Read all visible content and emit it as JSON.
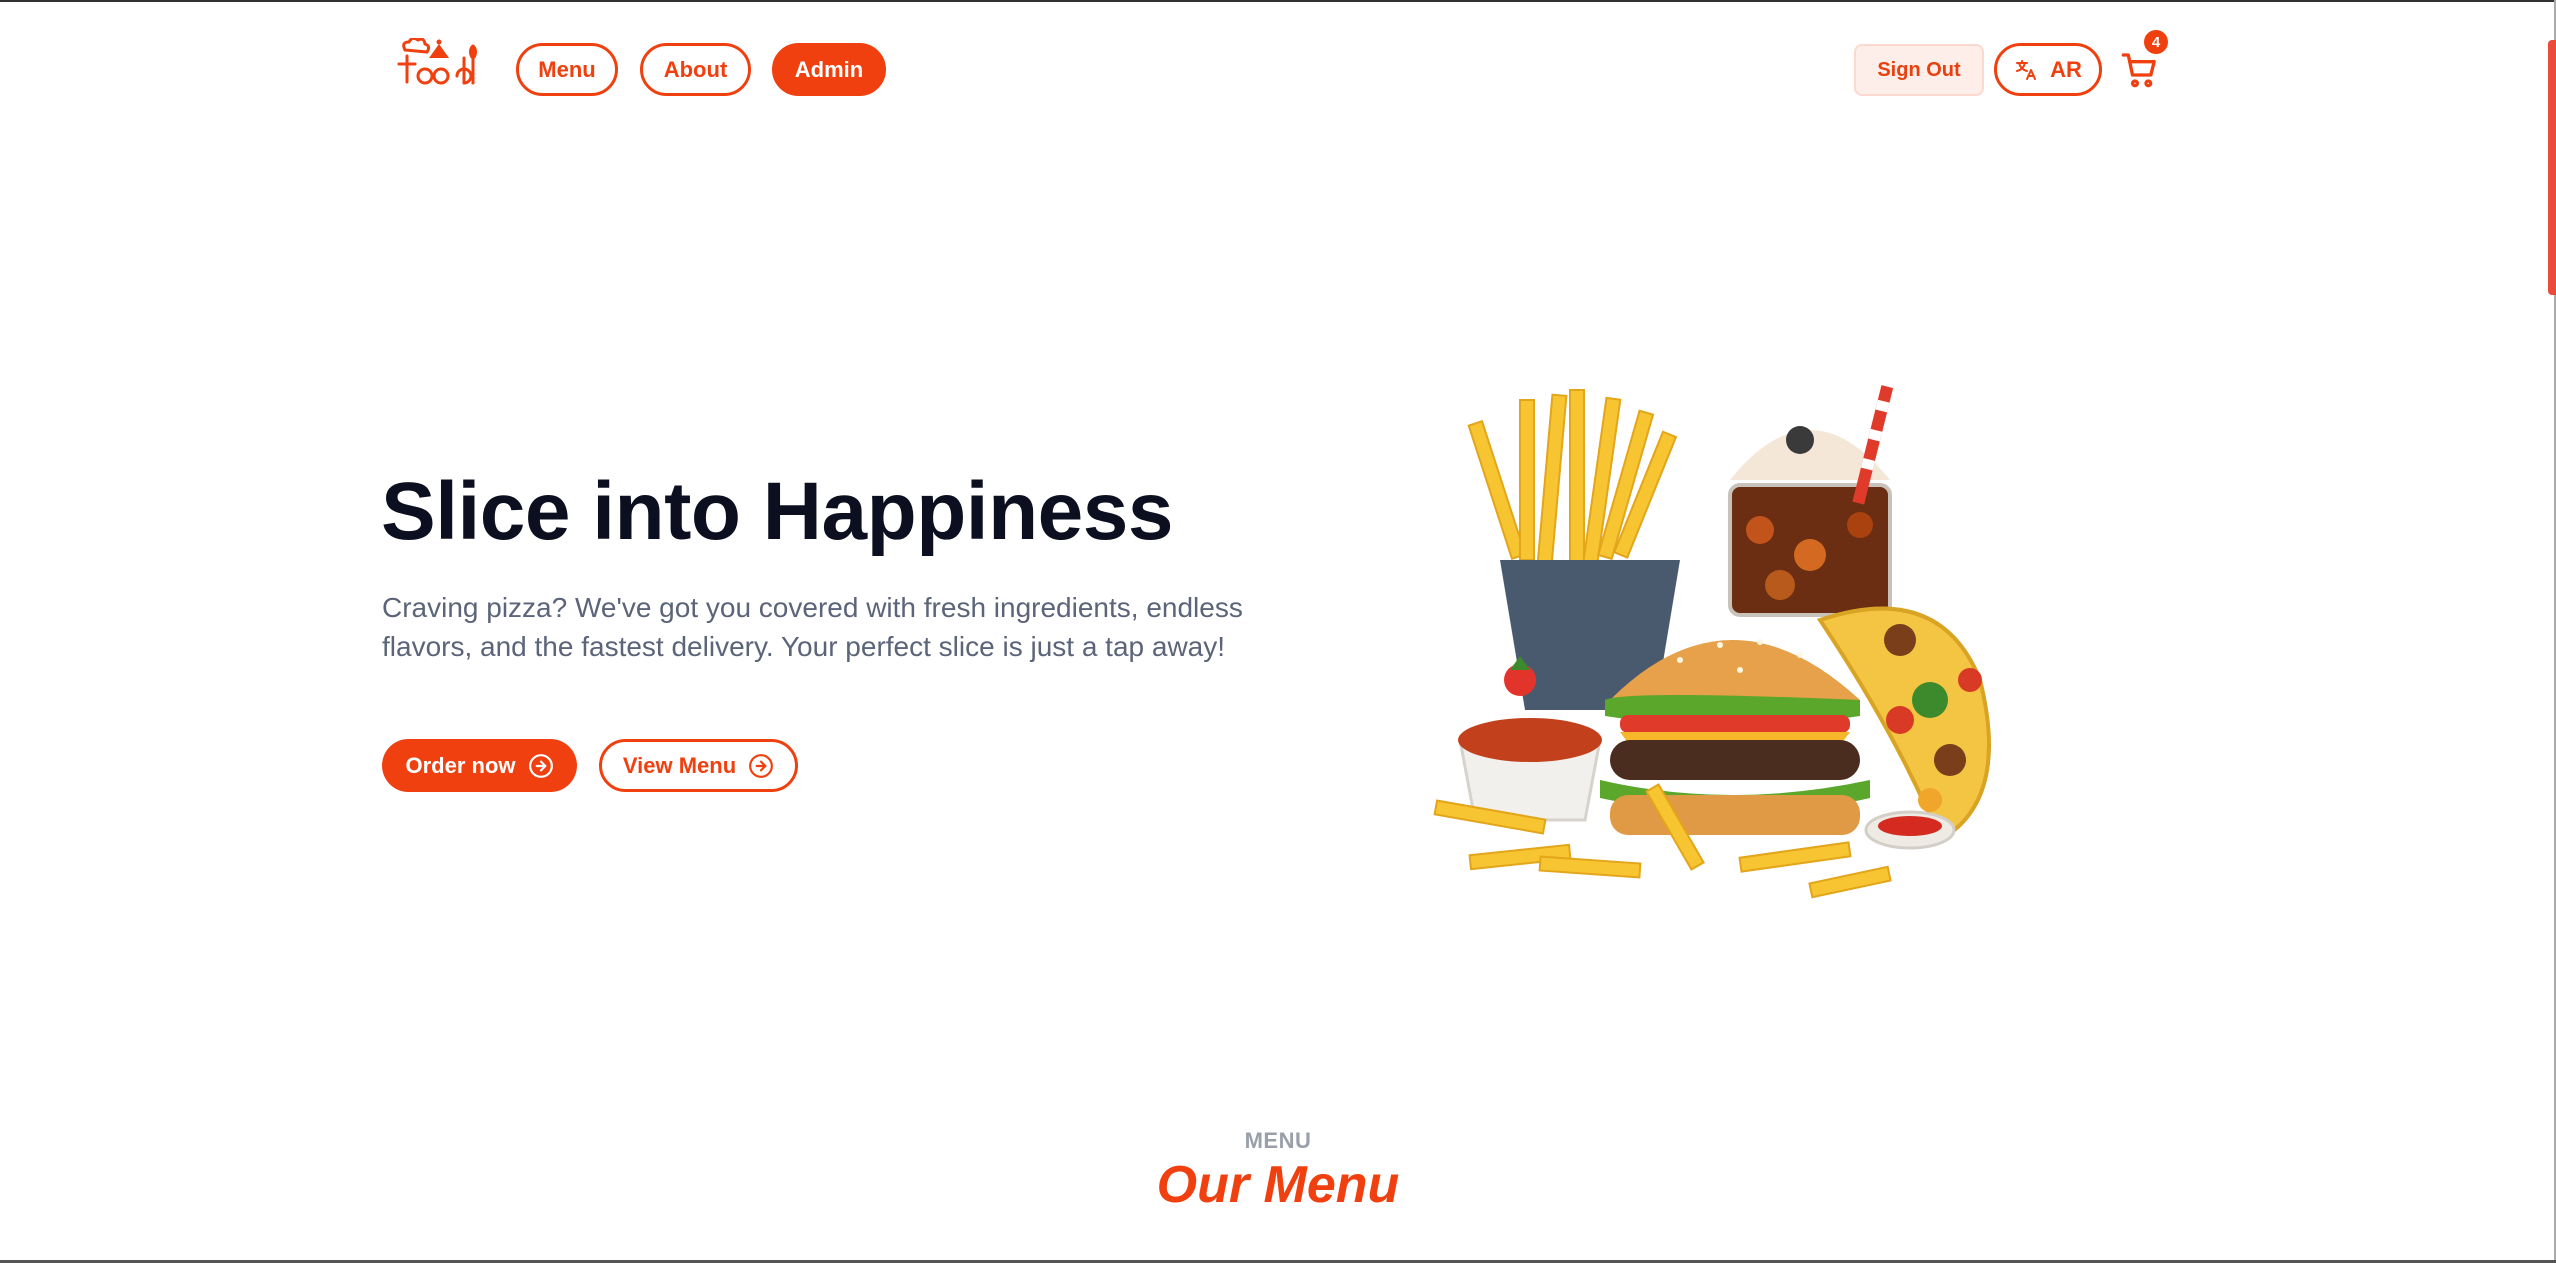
{
  "header": {
    "logo_text": "Food",
    "nav": [
      {
        "label": "Menu"
      },
      {
        "label": "About"
      },
      {
        "label": "Admin"
      }
    ],
    "sign_out_label": "Sign Out",
    "language_label": "AR",
    "cart_count": "4"
  },
  "hero": {
    "title": "Slice into Happiness",
    "description": "Craving pizza? We've got you covered with fresh ingredients, endless flavors, and the fastest delivery. Your perfect slice is just a tap away!",
    "order_button": "Order now",
    "view_menu_button": "View Menu"
  },
  "menu_section": {
    "kicker": "MENU",
    "title": "Our Menu"
  },
  "colors": {
    "accent": "#f0400f",
    "heading": "#0c0f1f",
    "body_text": "#5b6478"
  }
}
